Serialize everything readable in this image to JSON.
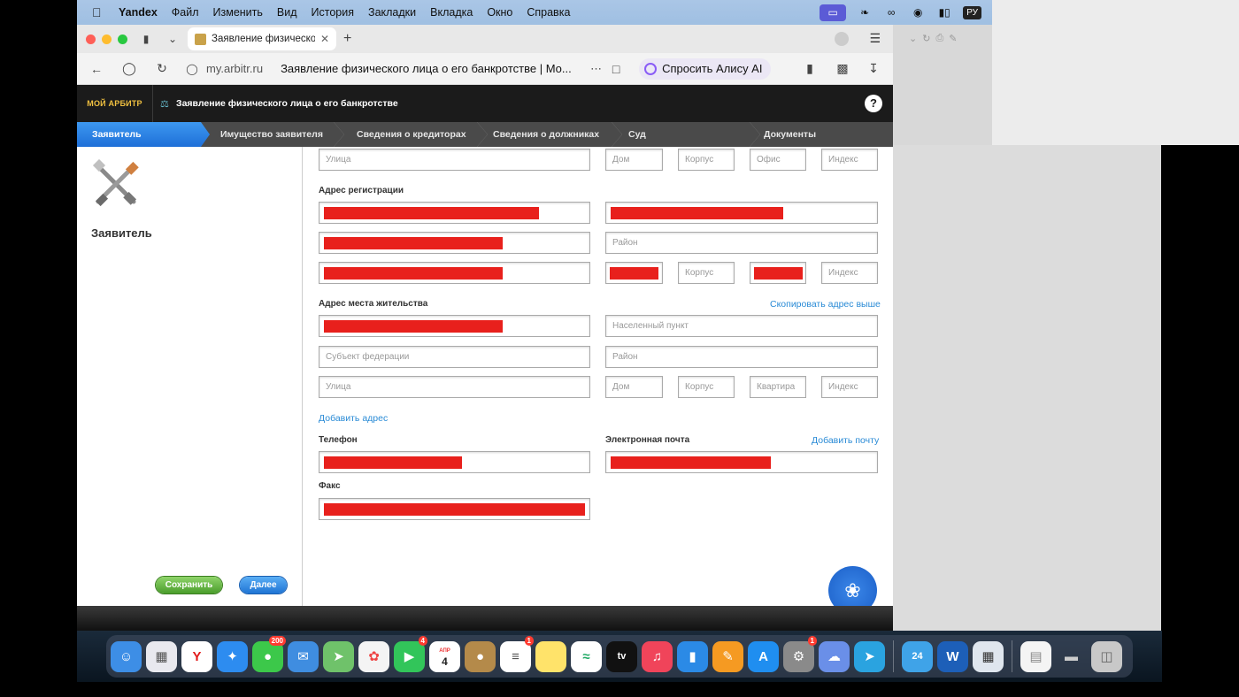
{
  "menubar": {
    "app_name": "Yandex",
    "items": [
      "Файл",
      "Изменить",
      "Вид",
      "История",
      "Закладки",
      "Вкладка",
      "Окно",
      "Справка"
    ],
    "lang": "РУ"
  },
  "browser": {
    "tab_title": "Заявление физическо",
    "domain": "my.arbitr.ru",
    "page_title": "Заявление физического лица о его банкротстве | Мо...",
    "alice_label": "Спросить Алису AI"
  },
  "app": {
    "logo_text": "МОЙ АРБИТР",
    "title": "Заявление физического лица о его банкротстве",
    "help": "?"
  },
  "steps": [
    "Заявитель",
    "Имущество заявителя",
    "Сведения о кредиторах",
    "Сведения о должниках",
    "Суд",
    "Документы"
  ],
  "sidebar": {
    "title": "Заявитель",
    "save": "Сохранить",
    "next": "Далее"
  },
  "form": {
    "top_row": {
      "street": "Улица",
      "house": "Дом",
      "building": "Корпус",
      "office": "Офис",
      "index": "Индекс"
    },
    "registration": {
      "label": "Адрес регистрации",
      "district": "Район",
      "building": "Корпус",
      "index": "Индекс"
    },
    "residence": {
      "label": "Адрес места жительства",
      "copy_link": "Скопировать адрес выше",
      "locality": "Населенный пункт",
      "subject": "Субъект федерации",
      "district": "Район",
      "street": "Улица",
      "house": "Дом",
      "building": "Корпус",
      "apartment": "Квартира",
      "index": "Индекс"
    },
    "add_address": "Добавить адрес",
    "phone_label": "Телефон",
    "email_label": "Электронная почта",
    "add_email": "Добавить почту",
    "fax_label": "Факс"
  },
  "dock": {
    "badges": {
      "messages": "200",
      "facetime": "4",
      "reminders": "1",
      "settings": "1"
    },
    "calendar_month": "АПР",
    "calendar_day": "4",
    "tv_label": "tv"
  },
  "colors": {
    "accent_blue": "#1e6fd8",
    "save_green": "#4a9d2c",
    "redaction": "#e8201c",
    "link": "#2a8bd6"
  }
}
